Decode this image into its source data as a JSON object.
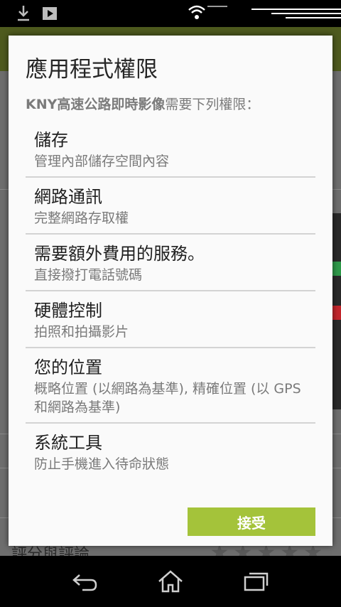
{
  "dialog": {
    "title": "應用程式權限",
    "intro_app": "KNY高速公路即時影像",
    "intro_suffix": "需要下列權限：",
    "accept_label": "接受"
  },
  "permissions": [
    {
      "title": "儲存",
      "desc": "管理內部儲存空間內容"
    },
    {
      "title": "網路通訊",
      "desc": "完整網路存取權"
    },
    {
      "title": "需要額外費用的服務。",
      "desc": "直接撥打電話號碼"
    },
    {
      "title": "硬體控制",
      "desc": "拍照和拍攝影片"
    },
    {
      "title": "您的位置",
      "desc": "概略位置 (以網路為基準), 精確位置 (以 GPS 和網路為基準)"
    },
    {
      "title": "系統工具",
      "desc": "防止手機進入待命狀態"
    }
  ],
  "background": {
    "rating_text": "評分與評論",
    "stars": "★★★★★"
  },
  "colors": {
    "accent": "#a4c33a",
    "actionbar": "#4e5a1e",
    "statusbar": "#000000"
  },
  "icons": [
    "download-icon",
    "play-store-icon",
    "wifi-icon",
    "signal-icon",
    "back-icon",
    "home-icon",
    "recents-icon"
  ]
}
